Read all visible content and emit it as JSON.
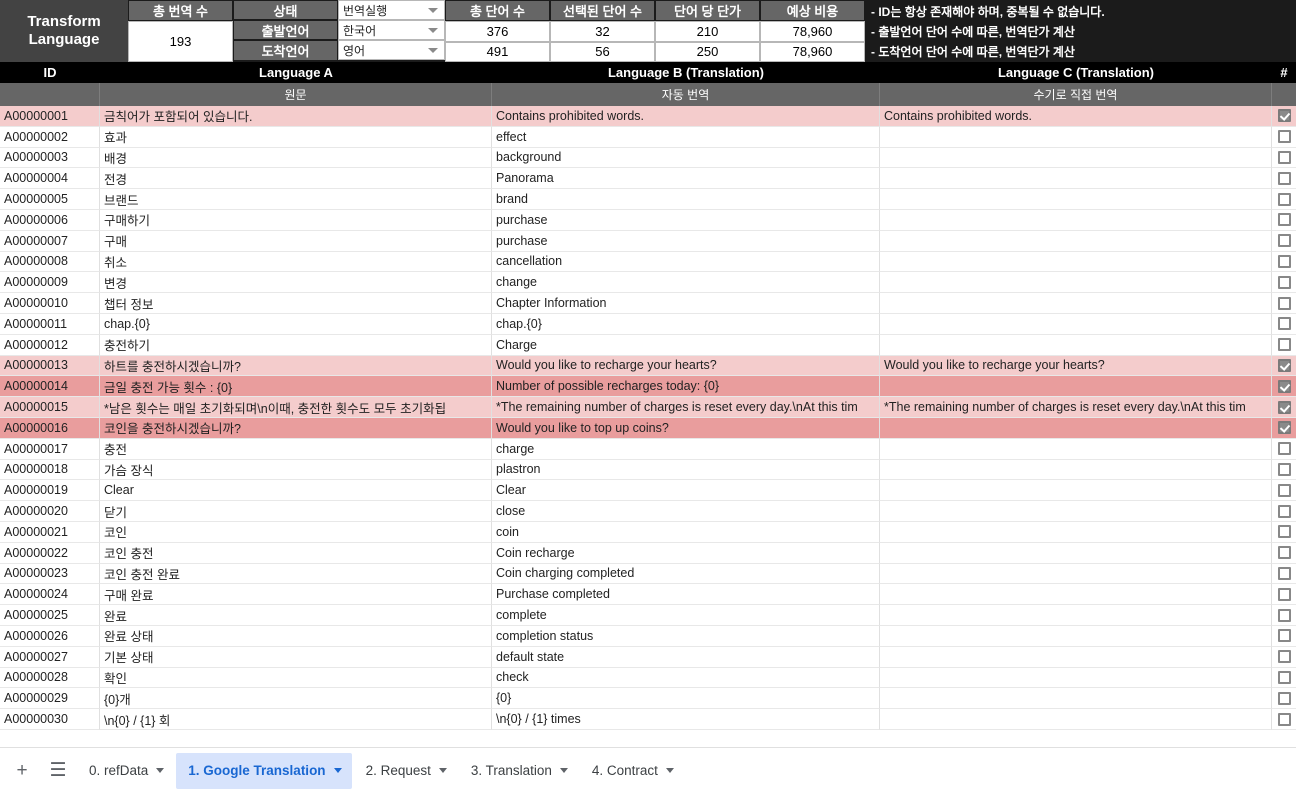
{
  "toolbar": {
    "app_title_line1": "Transform",
    "app_title_line2": "Language",
    "total_translations_label": "총 번역 수",
    "total_translations_value": "193",
    "status_label": "상태",
    "source_language_label": "출발언어",
    "target_language_label": "도착언어",
    "status_value": "번역실행",
    "source_language_value": "한국어",
    "target_language_value": "영어",
    "metrics": [
      {
        "label": "총 단어 수",
        "row1": "376",
        "row2": "491"
      },
      {
        "label": "선택된 단어 수",
        "row1": "32",
        "row2": "56"
      },
      {
        "label": "단어 당 단가",
        "row1": "210",
        "row2": "250"
      },
      {
        "label": "예상 비용",
        "row1": "78,960",
        "row2": "78,960"
      }
    ],
    "notes": [
      "- ID는 항상 존재해야 하며, 중복될 수 없습니다.",
      "- 출발언어 단어 수에 따른, 번역단가 계산",
      "- 도착언어 단어 수에 따른, 번역단가 계산"
    ]
  },
  "table": {
    "headers_top": [
      "ID",
      "Language A",
      "Language B (Translation)",
      "Language C (Translation)",
      "#"
    ],
    "headers_sub": [
      "",
      "원문",
      "자동 번역",
      "수기로 직접 번역",
      ""
    ],
    "rows": [
      {
        "id": "A00000001",
        "a": "금칙어가 포함되어 있습니다.",
        "b": "Contains prohibited words.",
        "c": "Contains prohibited words.",
        "checked": true,
        "hl": "light"
      },
      {
        "id": "A00000002",
        "a": "효과",
        "b": "effect",
        "c": "",
        "checked": false,
        "hl": ""
      },
      {
        "id": "A00000003",
        "a": "배경",
        "b": "background",
        "c": "",
        "checked": false,
        "hl": ""
      },
      {
        "id": "A00000004",
        "a": "전경",
        "b": "Panorama",
        "c": "",
        "checked": false,
        "hl": ""
      },
      {
        "id": "A00000005",
        "a": "브랜드",
        "b": "brand",
        "c": "",
        "checked": false,
        "hl": ""
      },
      {
        "id": "A00000006",
        "a": "구매하기",
        "b": "purchase",
        "c": "",
        "checked": false,
        "hl": ""
      },
      {
        "id": "A00000007",
        "a": "구매",
        "b": "purchase",
        "c": "",
        "checked": false,
        "hl": ""
      },
      {
        "id": "A00000008",
        "a": "취소",
        "b": "cancellation",
        "c": "",
        "checked": false,
        "hl": ""
      },
      {
        "id": "A00000009",
        "a": "변경",
        "b": "change",
        "c": "",
        "checked": false,
        "hl": ""
      },
      {
        "id": "A00000010",
        "a": "챕터 정보",
        "b": "Chapter Information",
        "c": "",
        "checked": false,
        "hl": ""
      },
      {
        "id": "A00000011",
        "a": "chap.{0}",
        "b": "chap.{0}",
        "c": "",
        "checked": false,
        "hl": ""
      },
      {
        "id": "A00000012",
        "a": "충전하기",
        "b": "Charge",
        "c": "",
        "checked": false,
        "hl": ""
      },
      {
        "id": "A00000013",
        "a": "하트를 충전하시겠습니까?",
        "b": "Would you like to recharge your hearts?",
        "c": "Would you like to recharge your hearts?",
        "checked": true,
        "hl": "light"
      },
      {
        "id": "A00000014",
        "a": "금일 충전 가능 횟수 : {0}",
        "b": "Number of possible recharges today: {0}",
        "c": "",
        "checked": true,
        "hl": "dark"
      },
      {
        "id": "A00000015",
        "a": "*남은 횟수는 매일 초기화되며\\n이때, 충전한 횟수도 모두 초기화됩",
        "b": "*The remaining number of charges is reset every day.\\nAt this tim",
        "c": "*The remaining number of charges is reset every day.\\nAt this tim",
        "checked": true,
        "hl": "light"
      },
      {
        "id": "A00000016",
        "a": "코인을 충전하시겠습니까?",
        "b": "Would you like to top up coins?",
        "c": "",
        "checked": true,
        "hl": "dark"
      },
      {
        "id": "A00000017",
        "a": "충전",
        "b": "charge",
        "c": "",
        "checked": false,
        "hl": ""
      },
      {
        "id": "A00000018",
        "a": "가슴 장식",
        "b": "plastron",
        "c": "",
        "checked": false,
        "hl": ""
      },
      {
        "id": "A00000019",
        "a": "Clear",
        "b": "Clear",
        "c": "",
        "checked": false,
        "hl": ""
      },
      {
        "id": "A00000020",
        "a": "닫기",
        "b": "close",
        "c": "",
        "checked": false,
        "hl": ""
      },
      {
        "id": "A00000021",
        "a": "코인",
        "b": "coin",
        "c": "",
        "checked": false,
        "hl": ""
      },
      {
        "id": "A00000022",
        "a": "코인 충전",
        "b": "Coin recharge",
        "c": "",
        "checked": false,
        "hl": ""
      },
      {
        "id": "A00000023",
        "a": "코인 충전 완료",
        "b": "Coin charging completed",
        "c": "",
        "checked": false,
        "hl": ""
      },
      {
        "id": "A00000024",
        "a": "구매 완료",
        "b": "Purchase completed",
        "c": "",
        "checked": false,
        "hl": ""
      },
      {
        "id": "A00000025",
        "a": "완료",
        "b": "complete",
        "c": "",
        "checked": false,
        "hl": ""
      },
      {
        "id": "A00000026",
        "a": "완료 상태",
        "b": "completion status",
        "c": "",
        "checked": false,
        "hl": ""
      },
      {
        "id": "A00000027",
        "a": "기본 상태",
        "b": "default state",
        "c": "",
        "checked": false,
        "hl": ""
      },
      {
        "id": "A00000028",
        "a": "확인",
        "b": "check",
        "c": "",
        "checked": false,
        "hl": ""
      },
      {
        "id": "A00000029",
        "a": "{0}개",
        "b": "{0}",
        "c": "",
        "checked": false,
        "hl": ""
      },
      {
        "id": "A00000030",
        "a": "\\n{0} / {1} 회",
        "b": "\\n{0} / {1} times",
        "c": "",
        "checked": false,
        "hl": ""
      }
    ]
  },
  "sheetbar": {
    "add_label": "+",
    "list_label": "☰",
    "tabs": [
      {
        "label": "0. refData",
        "active": false
      },
      {
        "label": "1. Google Translation",
        "active": true
      },
      {
        "label": "2. Request",
        "active": false
      },
      {
        "label": "3. Translation",
        "active": false
      },
      {
        "label": "4. Contract",
        "active": false
      }
    ]
  }
}
